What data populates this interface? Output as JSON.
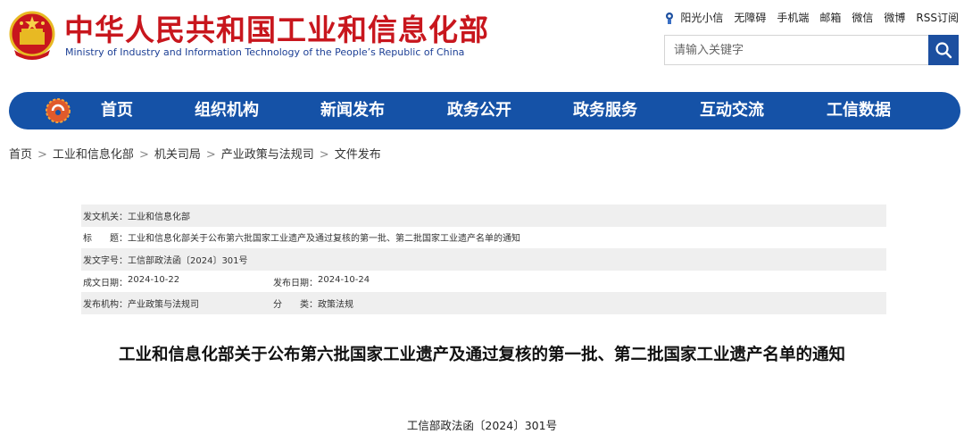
{
  "header": {
    "title_cn": "中华人民共和国工业和信息化部",
    "title_en": "Ministry of Industry and Information Technology of the People’s Republic of China",
    "toplinks": [
      "阳光小信",
      "无障碍",
      "手机端",
      "邮箱",
      "微信",
      "微博",
      "RSS订阅"
    ],
    "search_placeholder": "请输入关键字"
  },
  "nav": {
    "items": [
      "首页",
      "组织机构",
      "新闻发布",
      "政务公开",
      "政务服务",
      "互动交流",
      "工信数据"
    ]
  },
  "breadcrumb": [
    "首页",
    "工业和信息化部",
    "机关司局",
    "产业政策与法规司",
    "文件发布"
  ],
  "breadcrumb_sep": ">",
  "meta": {
    "issuer_label": "发文机关：",
    "issuer": "工业和信息化部",
    "title_label": "标　　题：",
    "title": "工业和信息化部关于公布第六批国家工业遗产及通过复核的第一批、第二批国家工业遗产名单的通知",
    "doc_no_label": "发文字号：",
    "doc_no": "工信部政法函〔2024〕301号",
    "created_label": "成文日期：",
    "created": "2024-10-22",
    "published_label": "发布日期：",
    "published": "2024-10-24",
    "org_label": "发布机构：",
    "org": "产业政策与法规司",
    "category_label": "分　　类：",
    "category": "政策法规"
  },
  "article": {
    "title": "工业和信息化部关于公布第六批国家工业遗产及通过复核的第一批、第二批国家工业遗产名单的通知",
    "doc_number": "工信部政法函〔2024〕301号"
  },
  "colors": {
    "brand_red": "#c8161d",
    "brand_blue": "#1552a7",
    "search_button": "#1c4fa0",
    "meta_shade": "#efefef"
  },
  "icons": {
    "emblem": "national-emblem-icon",
    "sun": "sun-icon",
    "search": "search-icon",
    "nav_logo": "ministry-logo-icon"
  }
}
